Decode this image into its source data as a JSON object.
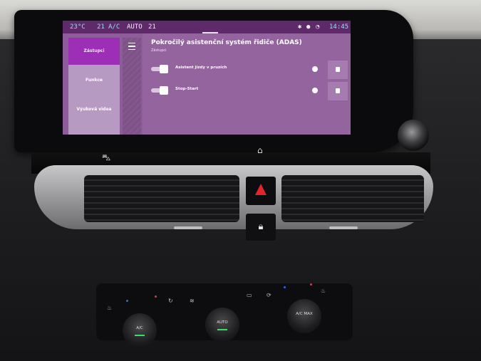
{
  "status_bar": {
    "temp_left": "23°C",
    "fan_level": "21",
    "ac_label": "A/C",
    "mode_label": "AUTO",
    "temp_right": "21",
    "clock": "14:45"
  },
  "sidebar": {
    "items": [
      {
        "label": "Zástupci",
        "active": true
      },
      {
        "label": "Funkce",
        "active": false
      },
      {
        "label": "Výuková videa",
        "active": false
      }
    ]
  },
  "header": {
    "title": "Pokročilý asistenční systém řidiče (ADAS)",
    "subtitle": "Zástupci"
  },
  "settings": [
    {
      "label": "Asistent jízdy v pruzích"
    },
    {
      "label": "Stop-Start"
    }
  ],
  "console": {
    "left_dial_label": "A/C",
    "center_dial_label": "AUTO",
    "right_dial_label": "A/C MAX"
  },
  "colors": {
    "screen_bg": "#8c5d98",
    "status_bg": "#5e2a6a",
    "active_tab": "#9c2fb6",
    "accent_cyan": "#8ee0f2",
    "hazard_red": "#e0262c",
    "led_green": "#35e06a"
  },
  "icons": {
    "menu": "hamburger-icon",
    "bluetooth": "bluetooth-icon",
    "profile": "profile-icon",
    "signal": "signal-icon",
    "car_shortcut": "car-icon",
    "home_shortcut": "home-icon",
    "hazard": "hazard-icon",
    "lock": "lock-icon"
  }
}
